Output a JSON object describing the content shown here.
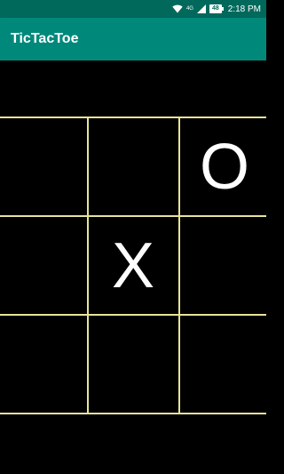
{
  "status_bar": {
    "network": "4G",
    "battery": "48",
    "time": "2:18 PM",
    "icons": [
      "wifi-icon",
      "cell-signal-icon",
      "battery-icon"
    ]
  },
  "app_bar": {
    "title": "TicTacToe"
  },
  "board": {
    "line_color": "#e8e39a",
    "cells": [
      "",
      "",
      "O",
      "",
      "X",
      "",
      "",
      "",
      ""
    ]
  },
  "colors": {
    "status_bar": "#00695c",
    "app_bar": "#00897b",
    "background": "#000000",
    "marks": "#ffffff"
  }
}
